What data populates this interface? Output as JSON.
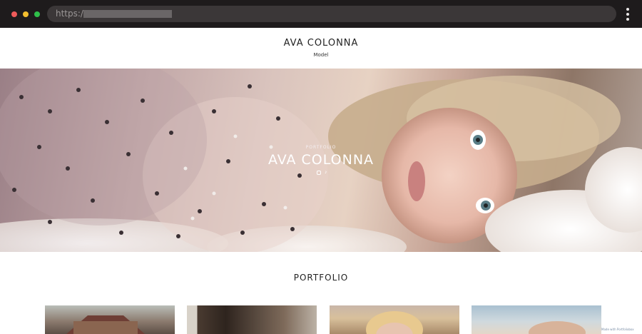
{
  "browser": {
    "url_scheme": "https://"
  },
  "site": {
    "title": "AVA COLONNA",
    "subtitle": "Model"
  },
  "hero": {
    "eyebrow": "PORTFOLIO",
    "title": "AVA COLONNA",
    "social_icons": [
      "instagram-icon",
      "tiktok-icon"
    ]
  },
  "portfolio": {
    "heading": "PORTFOLIO",
    "thumbnails": [
      "portfolio-thumb-1",
      "portfolio-thumb-2",
      "portfolio-thumb-3",
      "portfolio-thumb-4"
    ]
  },
  "footer": {
    "credit": "Made with Portfoliobox"
  },
  "colors": {
    "chrome_bg": "#1e1b1c",
    "url_bar": "#3b3738",
    "close": "#ee5b5a",
    "minimize": "#f3be2f",
    "maximize": "#2fbf4a"
  }
}
